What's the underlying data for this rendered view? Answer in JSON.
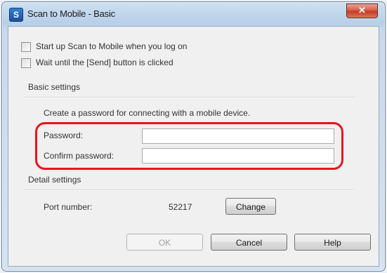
{
  "window": {
    "title": "Scan to Mobile - Basic",
    "icon": "app-s-icon",
    "close_glyph": "✕"
  },
  "options": {
    "startup_label": "Start up Scan to Mobile when you log on",
    "startup_checked": false,
    "wait_label": "Wait until the [Send] button is clicked",
    "wait_checked": false
  },
  "basic_settings": {
    "heading": "Basic settings",
    "description": "Create a password for connecting with a mobile device.",
    "password_label": "Password:",
    "password_value": "",
    "confirm_label": "Confirm password:",
    "confirm_value": ""
  },
  "detail_settings": {
    "heading": "Detail settings",
    "port_label": "Port number:",
    "port_value": "52217",
    "change_label": "Change"
  },
  "buttons": {
    "ok": "OK",
    "cancel": "Cancel",
    "help": "Help"
  },
  "colors": {
    "highlight": "#e8141c",
    "accent": "#1b4f97"
  }
}
